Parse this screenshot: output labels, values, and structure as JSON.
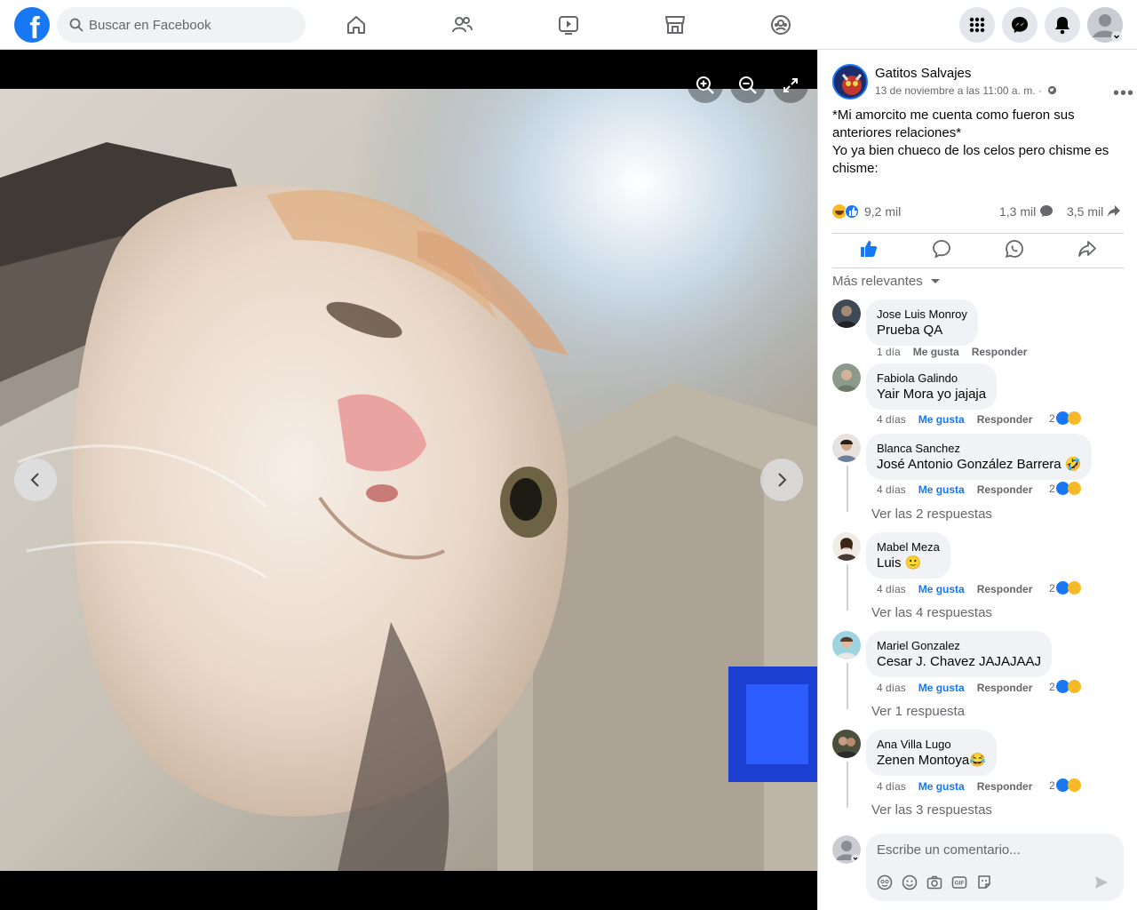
{
  "topbar": {
    "search_placeholder": "Buscar en Facebook"
  },
  "post": {
    "page_name": "Gatitos Salvajes",
    "date": "13 de noviembre a las 11:00 a. m. ·",
    "text": "*Mi amorcito me cuenta como fueron sus anteriores relaciones*\nYo ya bien chueco de los celos pero chisme es chisme:",
    "reactions": "9,2 mil",
    "comments_count": "1,3 mil",
    "shares_count": "3,5 mil"
  },
  "comments_filter": "Más relevantes",
  "comments": [
    {
      "name": "Jose Luis Monroy",
      "mention": "Prueba QA",
      "text": "",
      "time": "1 día",
      "like": "Me gusta",
      "reply": "Responder",
      "reactions": "",
      "replies": ""
    },
    {
      "name": "Fabiola Galindo",
      "mention": "Yair Mora",
      "text": " yo jajaja",
      "time": "4 días",
      "like": "Me gusta",
      "reply": "Responder",
      "reactions": "2",
      "replies": ""
    },
    {
      "name": "Blanca Sanchez",
      "mention": "José Antonio González Barrera",
      "text": " 🤣",
      "time": "4 días",
      "like": "Me gusta",
      "reply": "Responder",
      "reactions": "2",
      "replies": "Ver las 2 respuestas"
    },
    {
      "name": "Mabel Meza",
      "mention": "Luis",
      "text": " 🙂",
      "time": "4 días",
      "like": "Me gusta",
      "reply": "Responder",
      "reactions": "2",
      "replies": "Ver las 4 respuestas"
    },
    {
      "name": "Mariel Gonzalez",
      "mention": "Cesar J. Chavez",
      "text": " JAJAJAAJ",
      "time": "4 días",
      "like": "Me gusta",
      "reply": "Responder",
      "reactions": "2",
      "replies": "Ver 1 respuesta"
    },
    {
      "name": "Ana Villa Lugo",
      "mention": "Zenen Montoya",
      "text": "😂",
      "time": "4 días",
      "like": "Me gusta",
      "reply": "Responder",
      "reactions": "2",
      "replies": "Ver las 3 respuestas"
    }
  ],
  "write_comment_placeholder": "Escribe un comentario...",
  "colors": {
    "brand": "#1877f2",
    "secondary_text": "#65676b",
    "bubble": "#f0f2f5"
  },
  "icons": [
    "facebook-logo-icon",
    "search-icon",
    "home-icon",
    "friends-icon",
    "watch-icon",
    "marketplace-icon",
    "groups-icon",
    "menu-grid-icon",
    "messenger-icon",
    "notifications-icon",
    "zoom-in-icon",
    "zoom-out-icon",
    "fullscreen-icon",
    "prev-arrow-icon",
    "next-arrow-icon",
    "like-icon",
    "comment-icon",
    "whatsapp-icon",
    "share-icon",
    "more-icon"
  ]
}
